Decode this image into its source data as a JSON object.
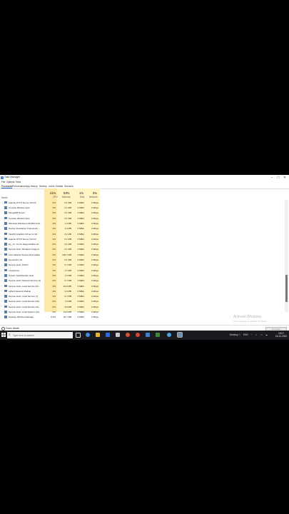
{
  "window": {
    "title": "Task Manager",
    "controls": [
      "–",
      "□",
      "✕"
    ]
  },
  "menu": [
    "File",
    "Options",
    "View"
  ],
  "tabs": [
    "Processes",
    "Performance",
    "App history",
    "Startup",
    "Users",
    "Details",
    "Services"
  ],
  "active_tab": "Processes",
  "columns": {
    "name": "Name",
    "cpu": {
      "label": "CPU",
      "pct": "21%"
    },
    "memory": {
      "label": "Memory",
      "pct": "53%"
    },
    "disk": {
      "label": "Disk",
      "pct": "1%"
    },
    "network": {
      "label": "Network",
      "pct": "0%"
    }
  },
  "processes": [
    {
      "name": "Apache HTTP Server (32 bit)",
      "expand": "",
      "cpu": "0%",
      "mem": "0.1 MB",
      "disk": "0 MB/s",
      "net": "0 Mbps"
    },
    {
      "name": "Console Window Host",
      "expand": "",
      "cpu": "0%",
      "mem": "0.1 MB",
      "disk": "0 MB/s",
      "net": "0 Mbps"
    },
    {
      "name": "MongoDB Server",
      "expand": "",
      "cpu": "0%",
      "mem": "0.1 MB",
      "disk": "0 MB/s",
      "net": "0 Mbps"
    },
    {
      "name": "Console Window Host",
      "expand": "",
      "cpu": "0%",
      "mem": "0.1 MB",
      "disk": "0 MB/s",
      "net": "0 Mbps"
    },
    {
      "name": "Windows Wireless LAN 802.11 E...",
      "expand": "",
      "cpu": "0%",
      "mem": "1.0 MB",
      "disk": "0 MB/s",
      "net": "0 Mbps"
    },
    {
      "name": "Device Association Framework ...",
      "expand": "",
      "cpu": "0%",
      "mem": "1.4 MB",
      "disk": "0 MB/s",
      "net": "0 Mbps"
    },
    {
      "name": "Intel(R) Graphics Driver for Wi...",
      "expand": "",
      "cpu": "0%",
      "mem": "0.1 MB",
      "disk": "0 MB/s",
      "net": "0 Mbps"
    },
    {
      "name": "Apache HTTP Server (32 bit)",
      "expand": "",
      "cpu": "0%",
      "mem": "0.1 MB",
      "disk": "0 MB/s",
      "net": "0 Mbps"
    },
    {
      "name": "jsy_v3 - Kumo bagsyreliable Ho...",
      "expand": "",
      "cpu": "0%",
      "mem": "0.1 MB",
      "disk": "0 MB/s",
      "net": "0 Mbps"
    },
    {
      "name": "Service Host: Windows Image A...",
      "expand": "›",
      "cpu": "0%",
      "mem": "0.1 MB",
      "disk": "0 MB/s",
      "net": "0 Mbps"
    },
    {
      "name": "Anti-malware Service Executable",
      "expand": "›",
      "cpu": "0%",
      "mem": "105.7 MB",
      "disk": "0 MB/s",
      "net": "0 Mbps"
    },
    {
      "name": "spoolsvSrv (2)",
      "expand": "›",
      "cpu": "0%",
      "mem": "0.1 MB",
      "disk": "0 MB/s",
      "net": "0 Mbps"
    },
    {
      "name": "Service Host: DCOm",
      "expand": "›",
      "cpu": "0%",
      "mem": "6.7 MB",
      "disk": "0 MB/s",
      "net": "0 Mbps"
    },
    {
      "name": "mysqld.exe",
      "expand": "›",
      "cpu": "0%",
      "mem": "1.7 MB",
      "disk": "0 MB/s",
      "net": "0 Mbps"
    },
    {
      "name": "System Spellchecker Host",
      "expand": "›",
      "cpu": "0%",
      "mem": "1.3 MB",
      "disk": "0 MB/s",
      "net": "0 Mbps"
    },
    {
      "name": "Service Host: Network Service (4)",
      "expand": "›",
      "cpu": "0%",
      "mem": "6.7 MB",
      "disk": "0 MB/s",
      "net": "0 Mbps"
    },
    {
      "name": "Service Host: Local Service (No...",
      "expand": "›",
      "cpu": "0%",
      "mem": "16.0 MB",
      "disk": "0 MB/s",
      "net": "0 Mbps"
    },
    {
      "name": "sqlite3 Network Module",
      "expand": "›",
      "cpu": "0%",
      "mem": "3.0 MB",
      "disk": "0 MB/s",
      "net": "0 Mbps"
    },
    {
      "name": "Service Host: Local Service (7)",
      "expand": "›",
      "cpu": "0%",
      "mem": "6.7 MB",
      "disk": "0 MB/s",
      "net": "0 Mbps"
    },
    {
      "name": "Service Host: Local Service (Net...",
      "expand": "›",
      "cpu": "0%",
      "mem": "7.3 MB",
      "disk": "0 MB/s",
      "net": "0 Mbps"
    },
    {
      "name": "Service Host: Local Service (Ne...",
      "expand": "›",
      "cpu": "0%",
      "mem": "6.8 MB",
      "disk": "0 MB/s",
      "net": "0 Mbps"
    },
    {
      "name": "Service Host: Local System (13)",
      "expand": "›",
      "cpu": "0%",
      "mem": "13.0 MB",
      "disk": "0 MB/s",
      "net": "0 Mbps"
    },
    {
      "name": "Desktop Window Manager",
      "expand": "",
      "cpu": "0.2%",
      "mem": "30.7 MB",
      "disk": "0 MB/s",
      "net": "0 Mbps"
    }
  ],
  "footer": {
    "fewer_details": "Fewer details",
    "end_task": "End task"
  },
  "watermark": {
    "line1": "Activate Windows",
    "line2": "Go to Settings to activate Windows."
  },
  "taskbar": {
    "search_placeholder": "Type here to search",
    "tray_desktop": "Desktop",
    "tray_lang": "ENG",
    "time": "19:07",
    "date": "16-12-2022"
  }
}
